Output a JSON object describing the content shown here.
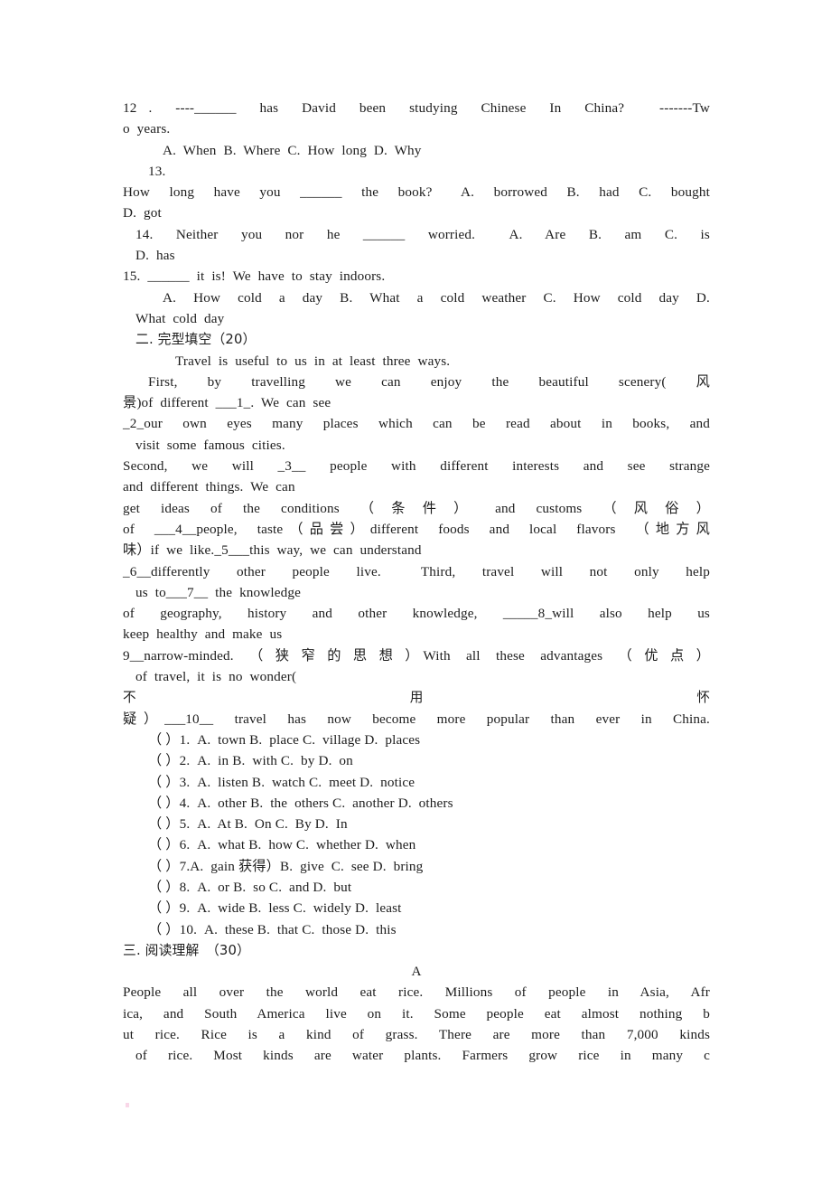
{
  "document": {
    "type": "english-exam-worksheet",
    "background_color": "#ffffff",
    "text_color": "#1c1c1c"
  },
  "section_one_tail": {
    "q12": {
      "stem_line1": "12 .  ----______  has  David  been  studying  Chinese  In  China?   -------Tw",
      "stem_line2": "o  years.",
      "options": "A.  When  B.  Where  C.  How  long  D.  Why"
    },
    "q13": {
      "number": "13.",
      "stem": "How  long  have  you  ______  the  book?   A.  borrowed  B.  had  C.  bought",
      "options_tail": "D.  got"
    },
    "q14": {
      "stem": "14.  Neither  you  nor  he  ______  worried.   A.  Are  B.  am  C.  is",
      "options_tail": "D.  has"
    },
    "q15": {
      "stem": "15.  ______  it  is!  We  have  to  stay  indoors.",
      "options_line1": "A.  How  cold  a  day  B.  What  a  cold  weather  C.  How  cold  day  D.",
      "options_line2": "What  cold  day"
    }
  },
  "section_two": {
    "heading": "二. 完型填空（20）",
    "passage_lines": [
      "Travel  is  useful  to  us  in  at  least  three  ways.",
      "First,  by  travelling  we  can  enjoy  the  beautiful  scenery(  风",
      "景)of  different  ___1_.  We  can  see",
      "_2_our  own  eyes  many  places  which  can  be  read  about  in  books,  and",
      "visit  some  famous  cities.",
      "Second,  we  will  _3__  people  with  different  interests  and  see  strange",
      "and  different  things.  We  can",
      "get  ideas  of  the  conditions  （ 条 件 ）  and  customs  （ 风 俗 ）",
      "of  ___4__people,  taste（品尝）different  foods  and  local  flavors  （地方风",
      "味）if  we  like._5___this  way,  we  can  understand",
      "_6__differently  other  people  live.   Third,  travel  will  not  only  help",
      "us  to___7__  the  knowledge",
      "of  geography,  history  and  other  knowledge,  _____8_will  also  help  us",
      "keep  healthy  and  make  us",
      "9__narrow-minded.  （ 狭 窄 的 思 想 ）With  all  these  advantages  （ 优 点 ）",
      "of  travel,  it  is  no  wonder("
    ],
    "spread_line": [
      "不",
      "用",
      "怀"
    ],
    "passage_tail": "疑）___10__  travel  has  now  become  more  popular  than  ever  in  China.",
    "questions": [
      "（ ）1.  A.  town B.  place C.  village D.  places",
      "（ ）2.  A.  in B.  with C.  by D.  on",
      "（ ）3.  A.  listen B.  watch C.  meet D.  notice",
      "（ ）4.  A.  other B.  the  others C.  another D.  others",
      "（ ）5.  A.  At B.  On C.  By D.  In",
      "（ ）6.  A.  what B.  how C.  whether D.  when",
      "（ ）7.A.  gain 获得）B.  give  C.  see D.  bring",
      "（ ）8.  A.  or B.  so C.  and D.  but",
      "（ ）9.  A.  wide B.  less C.  widely D.  least",
      "（ ）10.  A.  these B.  that C.  those D.  this"
    ]
  },
  "section_three": {
    "heading": "三. 阅读理解　（30）",
    "passage_label": "A",
    "passage_lines": [
      "People  all  over  the  world  eat  rice.  Millions  of  people  in  Asia,  Afr",
      "ica,  and  South  America  live  on  it.  Some  people  eat  almost  nothing  b",
      "ut  rice.  Rice  is  a  kind  of  grass.  There  are  more  than  7,000  kinds",
      "of  rice.  Most  kinds  are  water  plants.  Farmers  grow  rice  in  many  c"
    ]
  }
}
